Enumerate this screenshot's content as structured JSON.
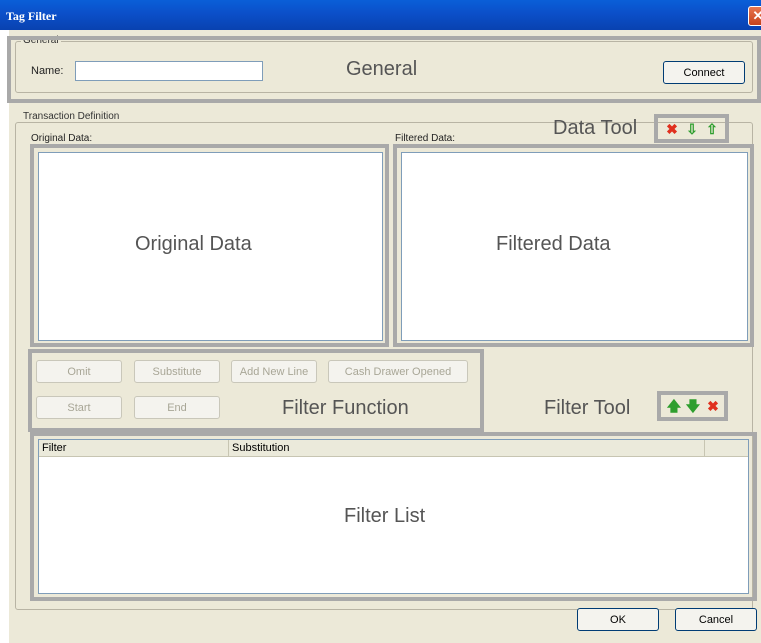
{
  "window": {
    "title": "Tag Filter",
    "close_glyph": "✕"
  },
  "general": {
    "group_label": "General",
    "name_label": "Name:",
    "name_value": "",
    "overlay_label": "General",
    "connect_label": "Connect"
  },
  "transaction": {
    "group_label": "Transaction Definition",
    "original_label": "Original Data:",
    "filtered_label": "Filtered Data:",
    "original_overlay": "Original Data",
    "filtered_overlay": "Filtered Data",
    "data_tool_label": "Data Tool",
    "data_tool_icons": [
      {
        "name": "delete-icon",
        "glyph": "✖",
        "color": "#e0301e"
      },
      {
        "name": "import-icon",
        "glyph": "⇩",
        "color": "#2e9e2e"
      },
      {
        "name": "export-icon",
        "glyph": "⇧",
        "color": "#2e9e2e"
      }
    ]
  },
  "filter_function": {
    "buttons": {
      "omit": "Omit",
      "substitute": "Substitute",
      "add_new_line": "Add New Line",
      "cash_drawer_opened": "Cash Drawer Opened",
      "start": "Start",
      "end": "End"
    },
    "overlay_label": "Filter Function"
  },
  "filter_tool": {
    "label": "Filter Tool",
    "icons": [
      {
        "name": "move-up-icon",
        "glyph": "🡅",
        "color": "#2e9e2e"
      },
      {
        "name": "move-down-icon",
        "glyph": "🡇",
        "color": "#2e9e2e"
      },
      {
        "name": "delete-icon",
        "glyph": "✖",
        "color": "#e0301e"
      }
    ]
  },
  "filter_list": {
    "columns": [
      "Filter",
      "Substitution"
    ],
    "rows": [],
    "overlay_label": "Filter List"
  },
  "footer": {
    "ok_label": "OK",
    "cancel_label": "Cancel"
  }
}
